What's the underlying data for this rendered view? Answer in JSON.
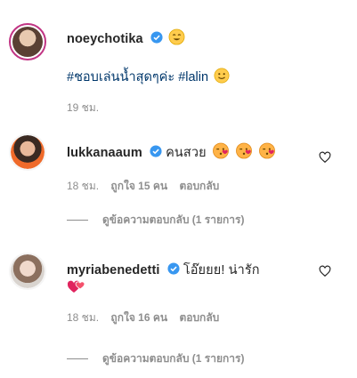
{
  "caption": {
    "username": "noeychotika",
    "hashtags": "#ชอบเล่นน้ำสุดๆค่ะ #lalin",
    "time": "19 ชม."
  },
  "comments": [
    {
      "username": "lukkanaaum",
      "text": "คนสวย",
      "time": "18 ชม.",
      "likes": "ถูกใจ 15 คน",
      "reply_label": "ตอบกลับ",
      "view_replies": "ดูข้อความตอบกลับ (1 รายการ)"
    },
    {
      "username": "myriabenedetti",
      "text": "โอ๊ยยย! น่ารัก",
      "time": "18 ชม.",
      "likes": "ถูกใจ 16 คน",
      "reply_label": "ตอบกลับ",
      "view_replies": "ดูข้อความตอบกลับ (1 รายการ)"
    }
  ],
  "colors": {
    "text": "#262626",
    "meta": "#8e8e8e",
    "hashtag": "#00376b",
    "verified": "#3897f0",
    "story_ring": "#c13584"
  }
}
